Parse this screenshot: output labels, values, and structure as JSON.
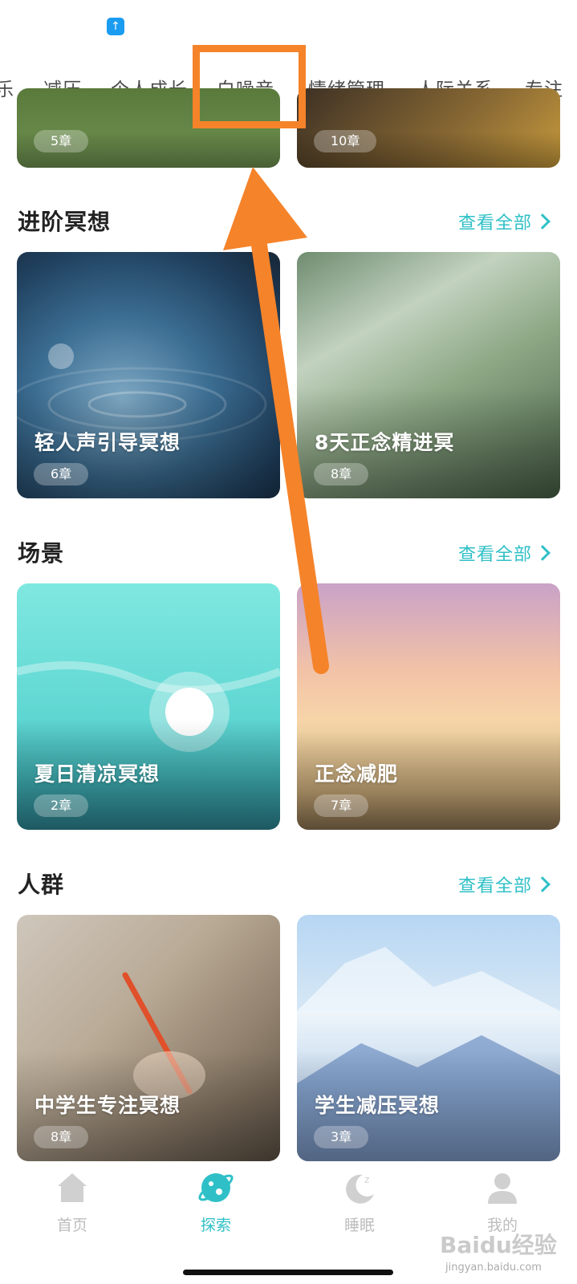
{
  "status_bar": {
    "badge_icon": "upload-arrow-icon"
  },
  "tabs": [
    {
      "label": "乐"
    },
    {
      "label": "减压"
    },
    {
      "label": "个人成长"
    },
    {
      "label": "白噪音"
    },
    {
      "label": "情绪管理"
    },
    {
      "label": "人际关系"
    },
    {
      "label": "专注"
    }
  ],
  "top_cards": [
    {
      "chapters": "5章"
    },
    {
      "chapters": "10章"
    }
  ],
  "sections": [
    {
      "title": "进阶冥想",
      "view_all": "查看全部",
      "cards": [
        {
          "title": "轻人声引导冥想",
          "chapters": "6章"
        },
        {
          "title": "8天正念精进冥",
          "chapters": "8章"
        }
      ]
    },
    {
      "title": "场景",
      "view_all": "查看全部",
      "cards": [
        {
          "title": "夏日清凉冥想",
          "chapters": "2章"
        },
        {
          "title": "正念减肥",
          "chapters": "7章"
        }
      ]
    },
    {
      "title": "人群",
      "view_all": "查看全部",
      "cards": [
        {
          "title": "中学生专注冥想",
          "chapters": "8章"
        },
        {
          "title": "学生减压冥想",
          "chapters": "3章"
        }
      ]
    }
  ],
  "bottom_nav": [
    {
      "label": "首页",
      "icon": "home-icon",
      "active": false
    },
    {
      "label": "探索",
      "icon": "explore-icon",
      "active": true
    },
    {
      "label": "睡眠",
      "icon": "moon-sleep-icon",
      "active": false
    },
    {
      "label": "我的",
      "icon": "profile-icon",
      "active": false
    }
  ],
  "watermark": {
    "text": "Baidu经验",
    "sub": "jingyan.baidu.com"
  },
  "colors": {
    "accent": "#2fc0c7",
    "annotation": "#f5832a"
  }
}
